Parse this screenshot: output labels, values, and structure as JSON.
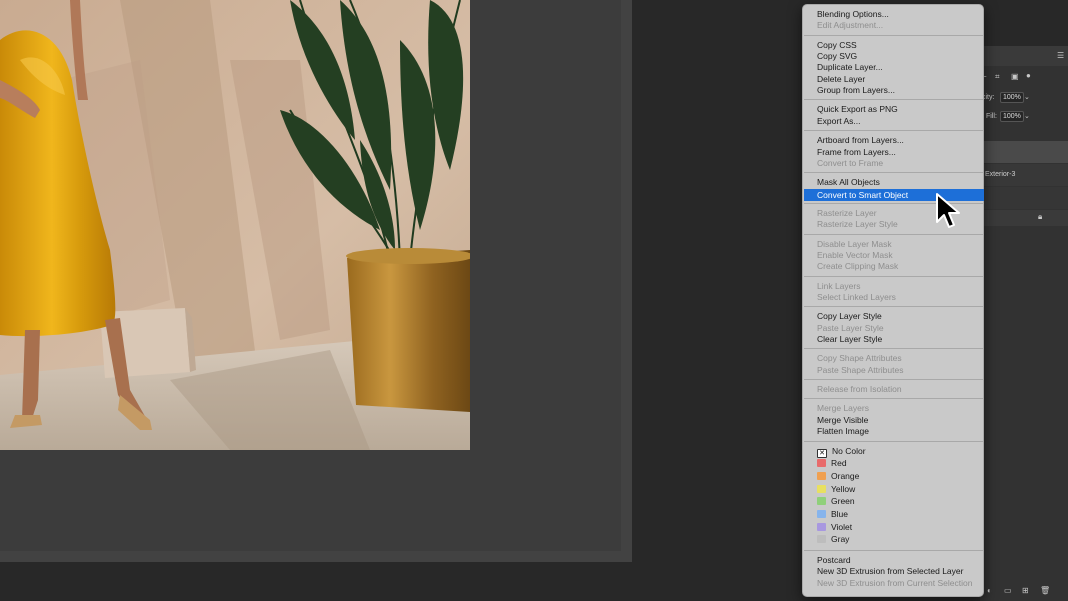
{
  "layers_panel": {
    "opacity_label": "city:",
    "opacity_value": "100%",
    "fill_label": "Fill:",
    "fill_value": "100%",
    "layer_name": "Exterior-3"
  },
  "menu": {
    "groups": [
      [
        {
          "label": "Blending Options...",
          "disabled": false
        },
        {
          "label": "Edit Adjustment...",
          "disabled": true
        }
      ],
      [
        {
          "label": "Copy CSS",
          "disabled": false
        },
        {
          "label": "Copy SVG",
          "disabled": false
        },
        {
          "label": "Duplicate Layer...",
          "disabled": false
        },
        {
          "label": "Delete Layer",
          "disabled": false
        },
        {
          "label": "Group from Layers...",
          "disabled": false
        }
      ],
      [
        {
          "label": "Quick Export as PNG",
          "disabled": false
        },
        {
          "label": "Export As...",
          "disabled": false
        }
      ],
      [
        {
          "label": "Artboard from Layers...",
          "disabled": false
        },
        {
          "label": "Frame from Layers...",
          "disabled": false
        },
        {
          "label": "Convert to Frame",
          "disabled": true
        }
      ],
      [
        {
          "label": "Mask All Objects",
          "disabled": false
        },
        {
          "label": "Convert to Smart Object",
          "disabled": false,
          "highlight": true
        }
      ],
      [
        {
          "label": "Rasterize Layer",
          "disabled": true
        },
        {
          "label": "Rasterize Layer Style",
          "disabled": true
        }
      ],
      [
        {
          "label": "Disable Layer Mask",
          "disabled": true
        },
        {
          "label": "Enable Vector Mask",
          "disabled": true
        },
        {
          "label": "Create Clipping Mask",
          "disabled": true
        }
      ],
      [
        {
          "label": "Link Layers",
          "disabled": true
        },
        {
          "label": "Select Linked Layers",
          "disabled": true
        }
      ],
      [
        {
          "label": "Copy Layer Style",
          "disabled": false
        },
        {
          "label": "Paste Layer Style",
          "disabled": true
        },
        {
          "label": "Clear Layer Style",
          "disabled": false
        }
      ],
      [
        {
          "label": "Copy Shape Attributes",
          "disabled": true
        },
        {
          "label": "Paste Shape Attributes",
          "disabled": true
        }
      ],
      [
        {
          "label": "Release from Isolation",
          "disabled": true
        }
      ],
      [
        {
          "label": "Merge Layers",
          "disabled": true
        },
        {
          "label": "Merge Visible",
          "disabled": false
        },
        {
          "label": "Flatten Image",
          "disabled": false
        }
      ],
      [
        {
          "label": "No Color",
          "disabled": false,
          "swatch": "none"
        },
        {
          "label": "Red",
          "disabled": false,
          "swatch": "#e86b6b"
        },
        {
          "label": "Orange",
          "disabled": false,
          "swatch": "#f0a050"
        },
        {
          "label": "Yellow",
          "disabled": false,
          "swatch": "#e8e060"
        },
        {
          "label": "Green",
          "disabled": false,
          "swatch": "#8fd07a"
        },
        {
          "label": "Blue",
          "disabled": false,
          "swatch": "#86b4ec"
        },
        {
          "label": "Violet",
          "disabled": false,
          "swatch": "#a898e0"
        },
        {
          "label": "Gray",
          "disabled": false,
          "swatch": "#bdbdbd"
        }
      ],
      [
        {
          "label": "Postcard",
          "disabled": false
        },
        {
          "label": "New 3D Extrusion from Selected Layer",
          "disabled": false
        },
        {
          "label": "New 3D Extrusion from Current Selection",
          "disabled": true
        }
      ]
    ]
  }
}
